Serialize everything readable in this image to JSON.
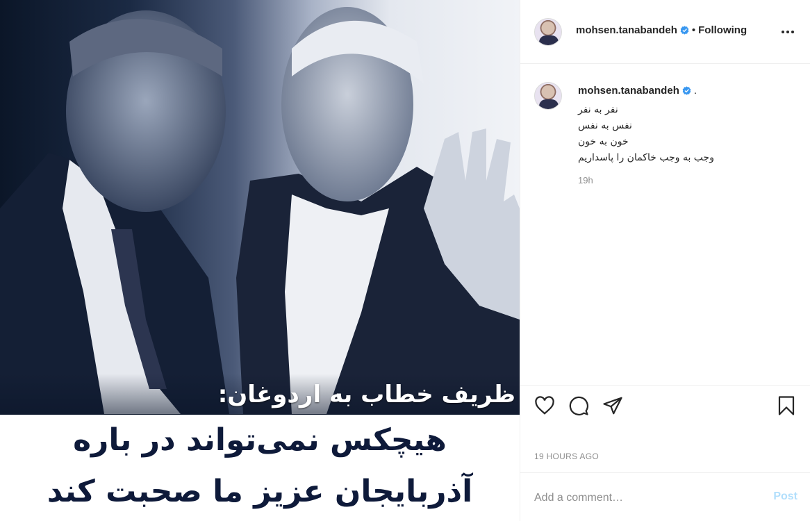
{
  "post": {
    "image_subtitle": "ظریف خطاب به اردوغان:",
    "image_headline_lines": [
      "هیچکس نمی‌تواند در باره",
      "آذربایجان عزیز ما صحبت کند"
    ]
  },
  "header": {
    "username": "mohsen.tanabandeh",
    "separator": "•",
    "follow_status": "Following"
  },
  "caption": {
    "username": "mohsen.tanabandeh",
    "trailing": ".",
    "lines": [
      "نفر به نفر",
      "نفس به نفس",
      "خون به خون",
      "وجب به وجب خاکمان را پاسداریم"
    ],
    "age": "19h"
  },
  "actions": {
    "icons": [
      "heart-icon",
      "comment-icon",
      "share-icon",
      "bookmark-icon"
    ]
  },
  "timestamp": "19 HOURS AGO",
  "comment_box": {
    "placeholder": "Add a comment…",
    "post_label": "Post"
  },
  "colors": {
    "verified_blue": "#3897f0",
    "post_disabled": "#b2dffc",
    "muted_text": "#8e8e8e"
  }
}
